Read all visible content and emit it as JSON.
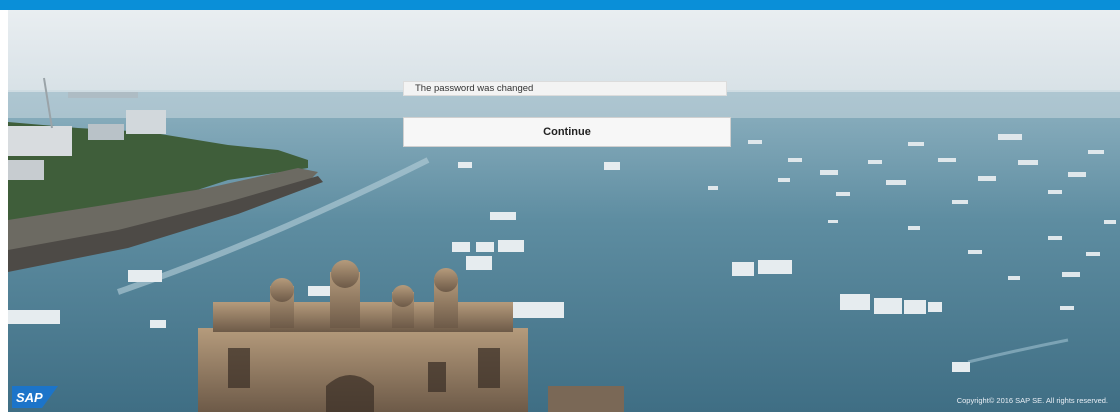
{
  "message": {
    "text": "The password was changed"
  },
  "actions": {
    "continue_label": "Continue"
  },
  "footer": {
    "copyright": "Copyright© 2016 SAP SE. All rights reserved."
  },
  "brand": {
    "logo_text": "SAP",
    "accent": "#0a8fd8",
    "logo_color": "#1c74c9"
  }
}
